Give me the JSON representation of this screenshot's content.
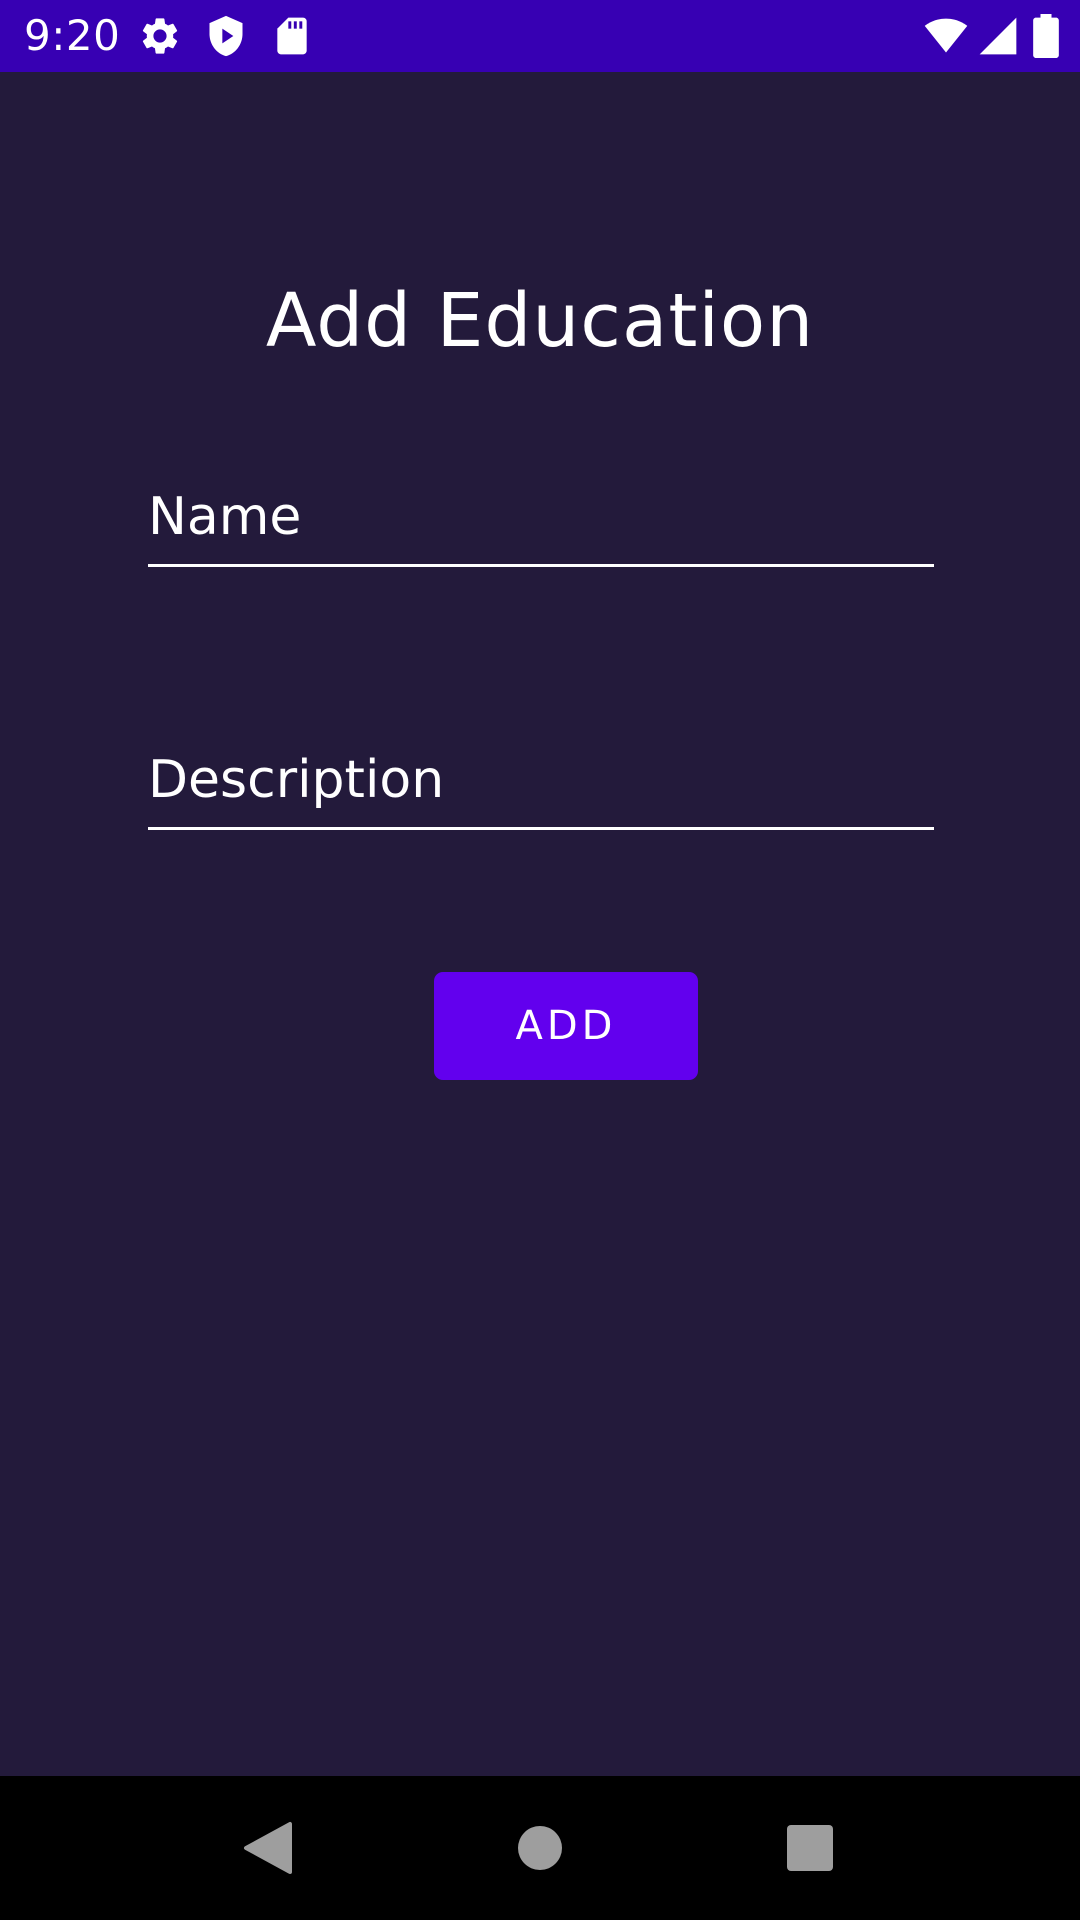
{
  "status_bar": {
    "time": "9:20",
    "background": "#3700b3",
    "left_icons": [
      "settings-icon",
      "play-protect-icon",
      "sd-card-icon"
    ],
    "right_icons": [
      "wifi-icon",
      "cell-signal-icon",
      "battery-icon"
    ]
  },
  "screen": {
    "title": "Add Education",
    "background": "#231a3b"
  },
  "form": {
    "name": {
      "value": "",
      "placeholder": "Name"
    },
    "description": {
      "value": "",
      "placeholder": "Description"
    },
    "add_button_label": "ADD",
    "accent": "#6200ee"
  },
  "nav_bar": {
    "buttons": [
      "back-icon",
      "home-icon",
      "recents-icon"
    ]
  }
}
